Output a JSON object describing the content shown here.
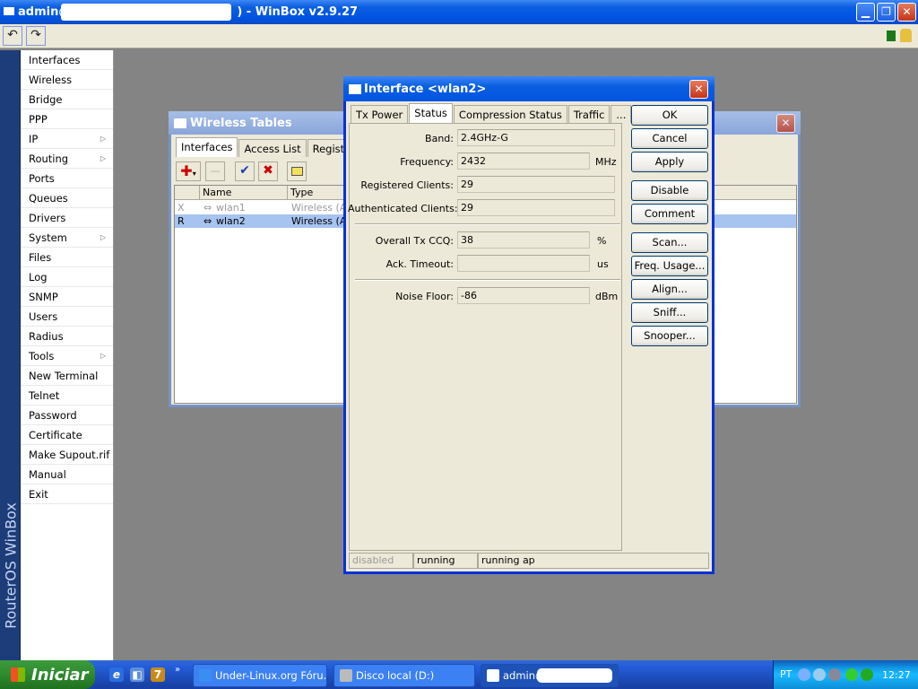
{
  "titlebar": {
    "title_prefix": "admin@",
    "title_suffix": ") - WinBox v2.9.27"
  },
  "toolbar": {
    "undo_label": "↶",
    "redo_label": "↷"
  },
  "brand": {
    "text": "RouterOS WinBox"
  },
  "menu": {
    "items": [
      {
        "label": "Interfaces"
      },
      {
        "label": "Wireless"
      },
      {
        "label": "Bridge"
      },
      {
        "label": "PPP"
      },
      {
        "label": "IP",
        "arrow": "▷"
      },
      {
        "label": "Routing",
        "arrow": "▷"
      },
      {
        "label": "Ports"
      },
      {
        "label": "Queues"
      },
      {
        "label": "Drivers"
      },
      {
        "label": "System",
        "arrow": "▷"
      },
      {
        "label": "Files"
      },
      {
        "label": "Log"
      },
      {
        "label": "SNMP"
      },
      {
        "label": "Users"
      },
      {
        "label": "Radius"
      },
      {
        "label": "Tools",
        "arrow": "▷"
      },
      {
        "label": "New Terminal"
      },
      {
        "label": "Telnet"
      },
      {
        "label": "Password"
      },
      {
        "label": "Certificate"
      },
      {
        "label": "Make Supout.rif"
      },
      {
        "label": "Manual"
      },
      {
        "label": "Exit"
      }
    ]
  },
  "wireless_tables": {
    "title": "Wireless Tables",
    "tabs": [
      "Interfaces",
      "Access List",
      "Registration"
    ],
    "columns": [
      "Name",
      "Type"
    ],
    "rows": [
      {
        "flag": "X",
        "name": "wlan1",
        "type": "Wireless (Ath"
      },
      {
        "flag": "R",
        "name": "wlan2",
        "type": "Wireless (Ath"
      }
    ]
  },
  "interface_dialog": {
    "title": "Interface <wlan2>",
    "tabs": [
      "Tx Power",
      "Status",
      "Compression Status",
      "Traffic",
      "..."
    ],
    "fields": {
      "band": {
        "label": "Band:",
        "value": "2.4GHz-G"
      },
      "frequency": {
        "label": "Frequency:",
        "value": "2432",
        "unit": "MHz"
      },
      "registered": {
        "label": "Registered Clients:",
        "value": "29"
      },
      "authenticated": {
        "label": "Authenticated Clients:",
        "value": "29"
      },
      "ccq": {
        "label": "Overall Tx CCQ:",
        "value": "38",
        "unit": "%"
      },
      "ack": {
        "label": "Ack. Timeout:",
        "value": "",
        "unit": "us"
      },
      "noise": {
        "label": "Noise Floor:",
        "value": "-86",
        "unit": "dBm"
      }
    },
    "buttons": [
      "OK",
      "Cancel",
      "Apply",
      "Disable",
      "Comment",
      "Scan...",
      "Freq. Usage...",
      "Align...",
      "Sniff...",
      "Snooper..."
    ],
    "statusbar": [
      "disabled",
      "running",
      "running ap"
    ]
  },
  "taskbar": {
    "start_label": "Iniciar",
    "tasks": [
      "Under-Linux.org Fóru...",
      "Disco local (D:)",
      "admin@"
    ],
    "lang": "PT",
    "clock": "12:27"
  },
  "colors": {
    "title_blue": "#0054e3",
    "selected_row": "#a7c3f0",
    "start_green": "#2e8b2e"
  }
}
